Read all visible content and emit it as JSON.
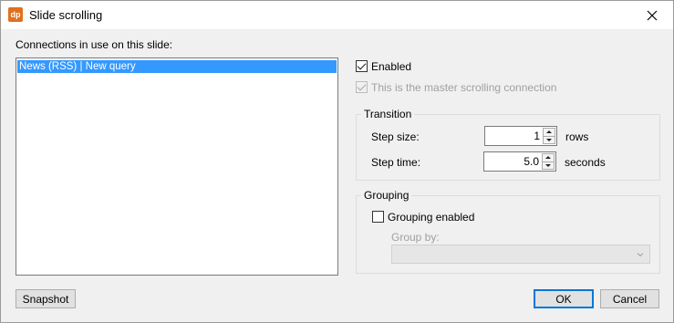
{
  "window": {
    "title": "Slide scrolling",
    "app_icon_text": "dp",
    "app_icon_color": "#e0701f"
  },
  "connections": {
    "label": "Connections in use on this slide:",
    "items": [
      "News (RSS) | New query"
    ],
    "selected_color": "#3399ff"
  },
  "options": {
    "enabled_label": "Enabled",
    "enabled_checked": true,
    "master_label": "This is the master scrolling connection",
    "master_checked": true,
    "master_disabled": true
  },
  "transition": {
    "title": "Transition",
    "step_size_label": "Step size:",
    "step_size_value": "1",
    "step_size_unit": "rows",
    "step_time_label": "Step time:",
    "step_time_value": "5.0",
    "step_time_unit": "seconds"
  },
  "grouping": {
    "title": "Grouping",
    "enabled_label": "Grouping enabled",
    "enabled_checked": false,
    "group_by_label": "Group by:",
    "group_by_value": ""
  },
  "buttons": {
    "snapshot": "Snapshot",
    "ok": "OK",
    "cancel": "Cancel"
  },
  "accent_color": "#0078d7"
}
